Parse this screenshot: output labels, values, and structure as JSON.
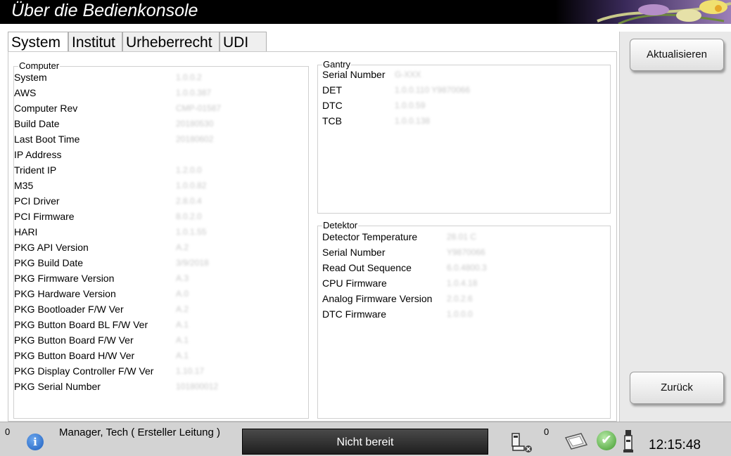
{
  "window": {
    "title": "Über die Bedienkonsole"
  },
  "tabs": [
    {
      "label": "System",
      "active": true
    },
    {
      "label": "Institut",
      "active": false
    },
    {
      "label": "Urheberrecht",
      "active": false
    },
    {
      "label": "UDI",
      "active": false
    }
  ],
  "computer": {
    "legend": "Computer",
    "rows": [
      {
        "label": "System",
        "value": "1.0.0.2"
      },
      {
        "label": "AWS",
        "value": "1.0.0.387"
      },
      {
        "label": "Computer Rev",
        "value": "CMP-01587"
      },
      {
        "label": "Build Date",
        "value": "20180530"
      },
      {
        "label": "Last Boot Time",
        "value": "20180602"
      },
      {
        "label": "IP Address",
        "value": ""
      },
      {
        "label": "Trident IP",
        "value": "1.2.0.0"
      },
      {
        "label": "M35",
        "value": "1.0.0.82"
      },
      {
        "label": "PCI Driver",
        "value": "2.8.0.4"
      },
      {
        "label": "PCI Firmware",
        "value": "8.0.2.0"
      },
      {
        "label": "HARI",
        "value": "1.0.1.55"
      },
      {
        "label": "PKG API Version",
        "value": "A.2"
      },
      {
        "label": "PKG Build Date",
        "value": "3/9/2018"
      },
      {
        "label": "PKG Firmware Version",
        "value": "A.3"
      },
      {
        "label": "PKG Hardware Version",
        "value": "A.0"
      },
      {
        "label": "PKG Bootloader F/W Ver",
        "value": "A.2"
      },
      {
        "label": "PKG Button Board BL F/W Ver",
        "value": "A.1"
      },
      {
        "label": "PKG Button Board F/W Ver",
        "value": "A.1"
      },
      {
        "label": "PKG Button Board H/W Ver",
        "value": "A.1"
      },
      {
        "label": "PKG Display Controller F/W Ver",
        "value": "1.10.17"
      },
      {
        "label": "PKG Serial Number",
        "value": "101800012"
      }
    ]
  },
  "gantry": {
    "legend": "Gantry",
    "rows": [
      {
        "label": "Serial Number",
        "value": "G-XXX"
      },
      {
        "label": "DET",
        "value": "1.0.0.110  Y9870066"
      },
      {
        "label": "DTC",
        "value": "1.0.0.59"
      },
      {
        "label": "TCB",
        "value": "1.0.0.138"
      }
    ]
  },
  "detektor": {
    "legend": "Detektor",
    "rows": [
      {
        "label": "Detector Temperature",
        "value": "28.01 C"
      },
      {
        "label": "Serial Number",
        "value": "Y9870066"
      },
      {
        "label": "Read Out Sequence",
        "value": "6.0.4800.3"
      },
      {
        "label": "CPU Firmware",
        "value": "1.0.4.18"
      },
      {
        "label": "Analog Firmware Version",
        "value": "2.0.2.6"
      },
      {
        "label": "DTC Firmware",
        "value": "1.0.0.0"
      }
    ]
  },
  "sidebar": {
    "refresh_label": "Aktualisieren",
    "back_label": "Zurück"
  },
  "statusbar": {
    "left_count": "0",
    "user": "Manager, Tech ( Ersteller Leitung )",
    "state": "Nicht bereit",
    "right_count": "0",
    "time": "12:15:48"
  },
  "colors": {
    "titlebar_bg": "#000000",
    "status_bg": "#d3d3d3",
    "notready_bg": "#2e2e2e",
    "sidebar_bg": "#e9e9e9"
  },
  "icons": [
    "info-icon",
    "device-error-icon",
    "cassette-icon",
    "check-icon",
    "device-icon"
  ]
}
